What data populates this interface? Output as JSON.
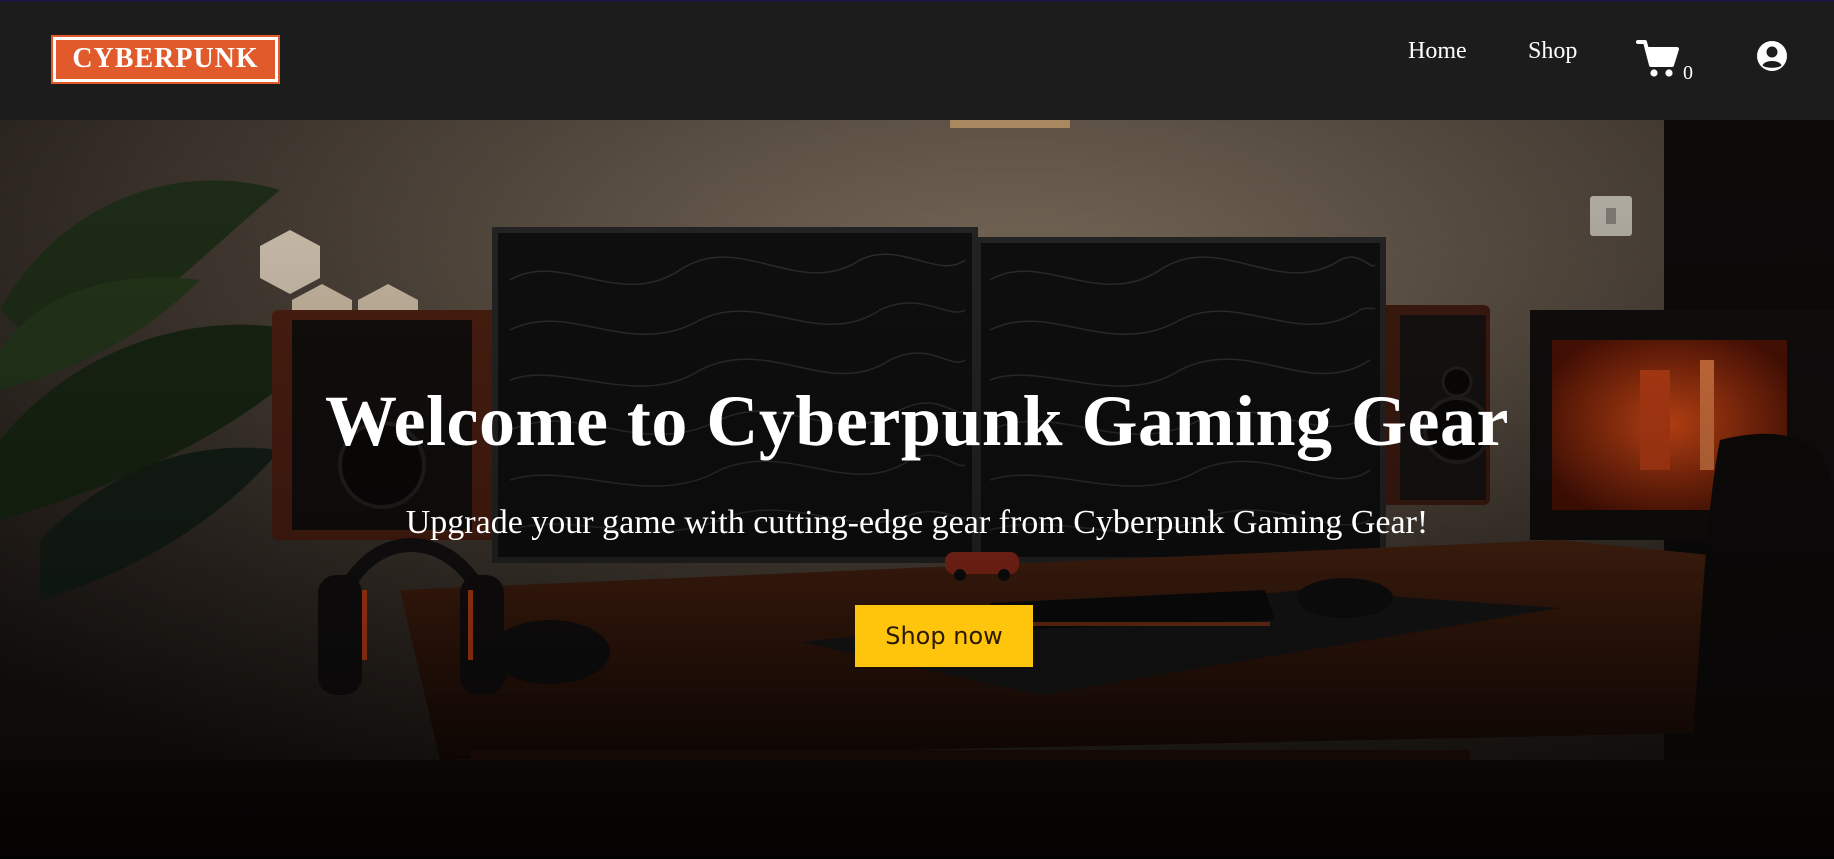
{
  "navbar": {
    "logo_text": "CYBERPUNK",
    "links": [
      {
        "label": "Home"
      },
      {
        "label": "Shop"
      }
    ],
    "cart_count": "0"
  },
  "hero": {
    "title": "Welcome to Cyberpunk Gaming Gear",
    "subtitle": "Upgrade your game with cutting-edge gear from Cyberpunk Gaming Gear!",
    "cta_label": "Shop now"
  },
  "colors": {
    "navbar_bg": "#1c1c1c",
    "logo_bg": "#e05a2b",
    "cta_bg": "#ffc40c",
    "text": "#ffffff"
  },
  "icons": {
    "cart": "shopping-cart-icon",
    "user": "user-account-icon"
  }
}
